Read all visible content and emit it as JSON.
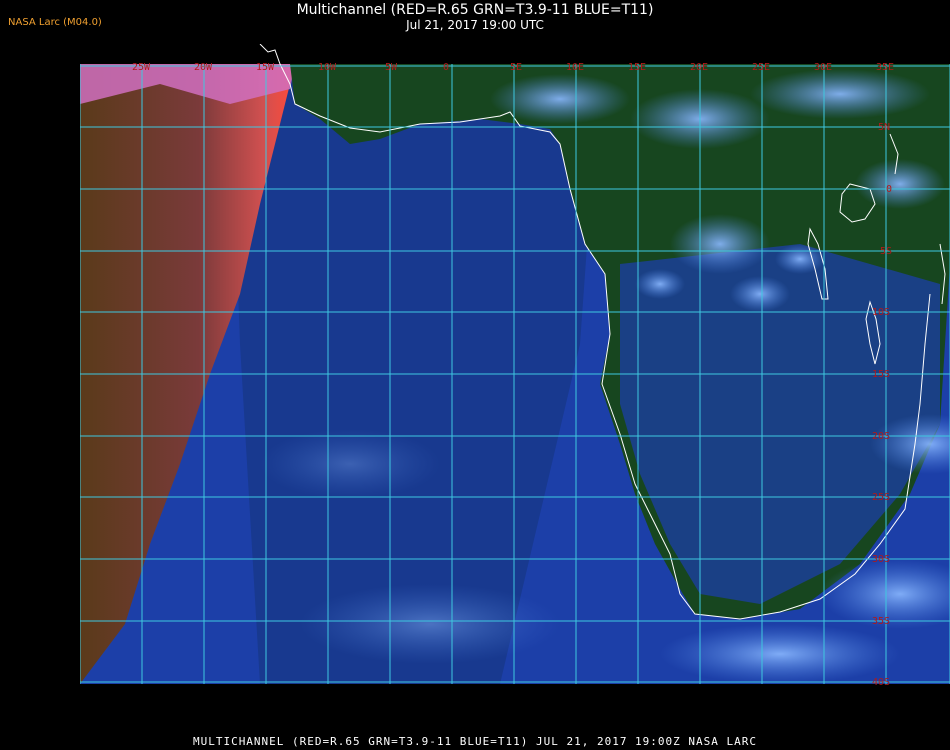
{
  "header": {
    "producer": "NASA Larc (M04.0)",
    "title": "Multichannel (RED=R.65 GRN=T3.9-11 BLUE=T11)",
    "subtitle": "Jul 21, 2017 19:00 UTC"
  },
  "footer": {
    "caption": "MULTICHANNEL (RED=R.65 GRN=T3.9-11 BLUE=T11)  JUL 21, 2017 19:00Z   NASA LARC"
  },
  "map": {
    "lon_labels": [
      "25W",
      "20W",
      "15W",
      "10W",
      "5W",
      "0",
      "5E",
      "10E",
      "15E",
      "20E",
      "25E",
      "30E",
      "35E"
    ],
    "lat_labels": [
      "5N",
      "0",
      "5S",
      "10S",
      "15S",
      "20S",
      "25S",
      "30S",
      "35S",
      "40S"
    ],
    "colors": {
      "grid": "#3ec8e0",
      "ocean": "#1a3fb0",
      "land": "#15421e",
      "terminator": "#e03030",
      "clouds": "#6aa0ff",
      "coast": "#ffffff",
      "labels": "#b11a1a"
    }
  }
}
